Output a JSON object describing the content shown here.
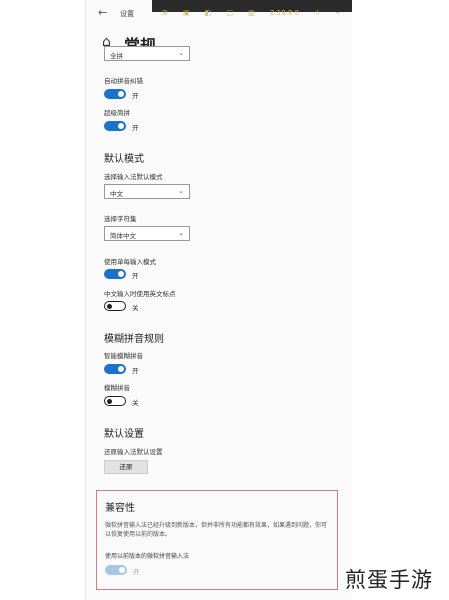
{
  "window": {
    "back_glyph": "←",
    "title": "设置",
    "tray": [
      "⊞",
      "▣",
      "◧",
      "□",
      "▥",
      "2:19:8 0",
      "☼",
      "⌁"
    ]
  },
  "page": {
    "title": "常规",
    "top_dropdown": {
      "value": "全拼"
    },
    "auto_pinyin": {
      "label": "自动拼音纠错",
      "state": "开"
    },
    "super_pinyin": {
      "label": "超级简拼",
      "state": "开"
    }
  },
  "default_mode": {
    "heading": "默认模式",
    "input_mode": {
      "label": "选择输入法默认模式",
      "value": "中文"
    },
    "charset": {
      "label": "选择字符集",
      "value": "简体中文"
    },
    "single_mode": {
      "label": "使用单每输入模式",
      "state": "开"
    },
    "cn_punct": {
      "label": "中文输入时使用英文标点",
      "state": "关"
    }
  },
  "fuzzy": {
    "heading": "模糊拼音规则",
    "smart_fuzzy": {
      "label": "智能模糊拼音",
      "state": "开"
    },
    "fuzzy_pinyin": {
      "label": "模糊拼音",
      "state": "关"
    }
  },
  "defaults": {
    "heading": "默认设置",
    "restore": {
      "label": "还原输入法默认设置",
      "button": "还原"
    }
  },
  "compat": {
    "heading": "兼容性",
    "description": "微软拼音输入法已经升级到新版本，但并非所有功能都有效果，如果遇到问题，你可以恢复使用以前的版本。",
    "option_label": "使用以前版本的微软拼音输入法",
    "state": "开"
  },
  "watermark": "煎蛋手游"
}
